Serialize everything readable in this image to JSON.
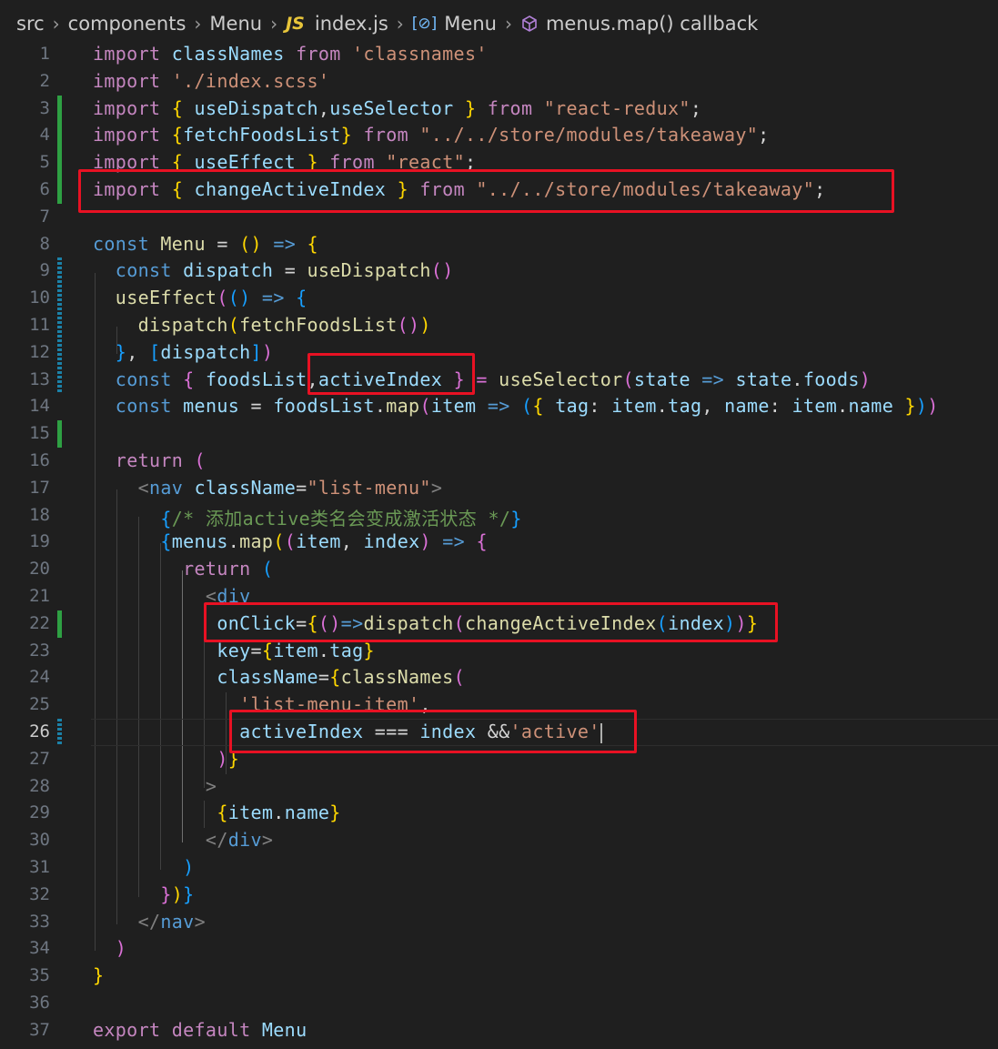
{
  "breadcrumb": {
    "src": "src",
    "components": "components",
    "menu_folder": "Menu",
    "js_badge": "JS",
    "file": "index.js",
    "symbol_icon": "[⊘]",
    "symbol": "Menu",
    "callback": "menus.map() callback"
  },
  "line_numbers": [
    "1",
    "2",
    "3",
    "4",
    "5",
    "6",
    "7",
    "8",
    "9",
    "10",
    "11",
    "12",
    "13",
    "14",
    "15",
    "16",
    "17",
    "18",
    "19",
    "20",
    "21",
    "22",
    "23",
    "24",
    "25",
    "26",
    "27",
    "28",
    "29",
    "30",
    "31",
    "32",
    "33",
    "34",
    "35",
    "36",
    "37"
  ],
  "code": {
    "l1": [
      "import",
      " classNames ",
      "from",
      " 'classnames'"
    ],
    "l2": [
      "import",
      " './index.scss'"
    ],
    "l3": [
      "import",
      " { ",
      "useDispatch",
      ",",
      "useSelector",
      " } ",
      "from",
      " \"react-redux\"",
      ";"
    ],
    "l4": [
      "import",
      " {",
      "fetchFoodsList",
      "} ",
      "from",
      " \"../../store/modules/takeaway\"",
      ";"
    ],
    "l5": [
      "import",
      " { ",
      "useEffect",
      " } ",
      "from",
      " \"react\"",
      ";"
    ],
    "l6": [
      "import",
      " { ",
      "changeActiveIndex",
      " } ",
      "from",
      " \"../../store/modules/takeaway\"",
      ";"
    ],
    "l8": [
      "const",
      " Menu",
      " = ",
      "()",
      " => ",
      "{"
    ],
    "l9": [
      "const",
      " dispatch",
      " = ",
      "useDispatch",
      "()"
    ],
    "l10": [
      "useEffect",
      "(",
      "()",
      " => ",
      "{"
    ],
    "l11": [
      "dispatch",
      "(",
      "fetchFoodsList",
      "()",
      ")"
    ],
    "l12": [
      "}",
      ", ",
      "[",
      "dispatch",
      "]",
      ")"
    ],
    "l13": [
      "const",
      " { ",
      "foodsList",
      ",",
      "activeIndex",
      " } = ",
      "useSelector",
      "(",
      "state",
      " => ",
      "state",
      ".",
      "foods",
      ")"
    ],
    "l14": [
      "const",
      " menus",
      " = ",
      "foodsList",
      ".",
      "map",
      "(",
      "item",
      " => ",
      "(",
      "{",
      " tag",
      ": ",
      "item",
      ".",
      "tag",
      ", ",
      "name",
      ": ",
      "item",
      ".",
      "name",
      " }",
      ")",
      ")"
    ],
    "l16": [
      "return",
      " ("
    ],
    "l17": [
      "<",
      "nav",
      " className",
      "=",
      "\"list-menu\"",
      ">"
    ],
    "l18": [
      "{",
      "/* 添加active类名会变成激活状态 */",
      "}"
    ],
    "l19": [
      "{",
      "menus",
      ".",
      "map",
      "(",
      "(",
      "item",
      ", ",
      "index",
      ")",
      " => ",
      "{"
    ],
    "l20": [
      "return",
      " ("
    ],
    "l21": [
      "<",
      "div"
    ],
    "l22": [
      "onClick",
      "=",
      "{",
      "()",
      "=>",
      "dispatch",
      "(",
      "changeActiveIndex",
      "(",
      "index",
      ")",
      ")",
      "}"
    ],
    "l23": [
      "key",
      "=",
      "{",
      "item",
      ".",
      "tag",
      "}"
    ],
    "l24": [
      "className",
      "=",
      "{",
      "classNames",
      "("
    ],
    "l25": [
      "'list-menu-item'",
      ","
    ],
    "l26": [
      "activeIndex",
      " === ",
      "index",
      " &&",
      "'active'"
    ],
    "l27": [
      ")",
      "}"
    ],
    "l28": [
      ">"
    ],
    "l29": [
      "{",
      "item",
      ".",
      "name",
      "}"
    ],
    "l30": [
      "</",
      "div",
      ">"
    ],
    "l31": [
      ")"
    ],
    "l32": [
      "}",
      ")",
      "}"
    ],
    "l33": [
      "</",
      "nav",
      ">"
    ],
    "l34": [
      ")"
    ],
    "l35": [
      "}"
    ],
    "l37": [
      "export",
      " default",
      " Menu"
    ]
  }
}
